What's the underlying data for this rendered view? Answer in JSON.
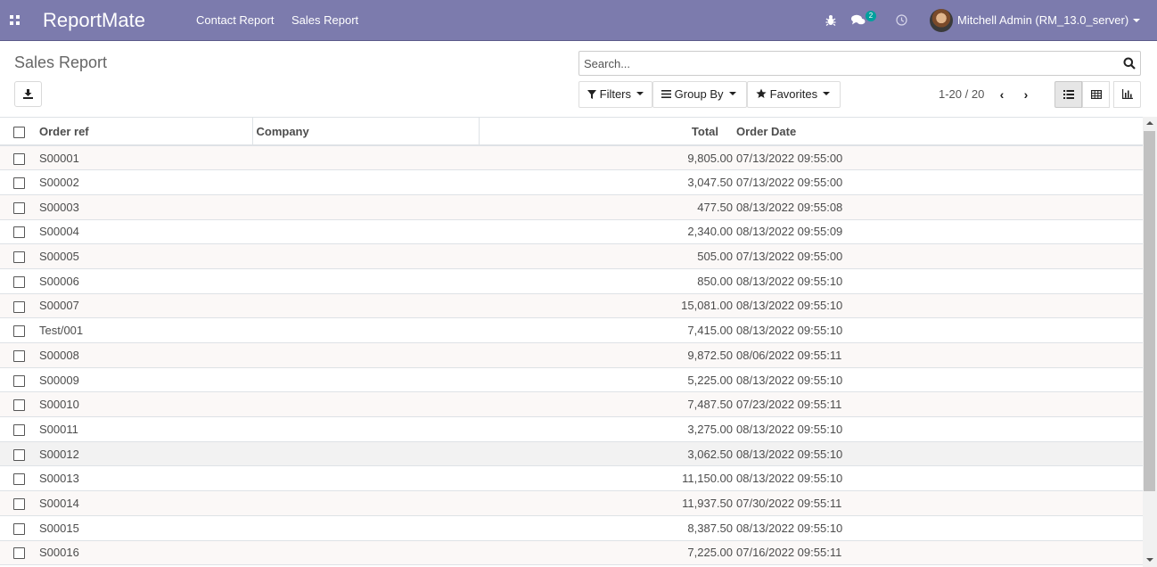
{
  "navbar": {
    "brand": "ReportMate",
    "menu": [
      "Contact Report",
      "Sales Report"
    ],
    "messages_badge": "2",
    "user_name": "Mitchell Admin (RM_13.0_server)",
    "icons": {
      "apps": "apps-grid-icon",
      "debug": "bug-icon",
      "messages": "chat-bubbles-icon",
      "activity": "clock-icon",
      "user_menu": "caret-down-icon"
    },
    "color": "#7c7bad"
  },
  "control_panel": {
    "breadcrumb": "Sales Report",
    "search_placeholder": "Search...",
    "filters_label": "Filters",
    "group_by_label": "Group By",
    "favorites_label": "Favorites",
    "pager": "1-20 / 20",
    "views": [
      "list",
      "pivot",
      "graph"
    ],
    "active_view": "list"
  },
  "list": {
    "columns": [
      "Order ref",
      "Company",
      "Total",
      "Order Date"
    ],
    "rows": [
      {
        "ref": "S00001",
        "company": "",
        "total": "9,805.00",
        "date": "07/13/2022 09:55:00"
      },
      {
        "ref": "S00002",
        "company": "",
        "total": "3,047.50",
        "date": "07/13/2022 09:55:00"
      },
      {
        "ref": "S00003",
        "company": "",
        "total": "477.50",
        "date": "08/13/2022 09:55:08"
      },
      {
        "ref": "S00004",
        "company": "",
        "total": "2,340.00",
        "date": "08/13/2022 09:55:09"
      },
      {
        "ref": "S00005",
        "company": "",
        "total": "505.00",
        "date": "07/13/2022 09:55:00"
      },
      {
        "ref": "S00006",
        "company": "",
        "total": "850.00",
        "date": "08/13/2022 09:55:10"
      },
      {
        "ref": "S00007",
        "company": "",
        "total": "15,081.00",
        "date": "08/13/2022 09:55:10"
      },
      {
        "ref": "Test/001",
        "company": "",
        "total": "7,415.00",
        "date": "08/13/2022 09:55:10"
      },
      {
        "ref": "S00008",
        "company": "",
        "total": "9,872.50",
        "date": "08/06/2022 09:55:11"
      },
      {
        "ref": "S00009",
        "company": "",
        "total": "5,225.00",
        "date": "08/13/2022 09:55:10"
      },
      {
        "ref": "S00010",
        "company": "",
        "total": "7,487.50",
        "date": "07/23/2022 09:55:11"
      },
      {
        "ref": "S00011",
        "company": "",
        "total": "3,275.00",
        "date": "08/13/2022 09:55:10"
      },
      {
        "ref": "S00012",
        "company": "",
        "total": "3,062.50",
        "date": "08/13/2022 09:55:10"
      },
      {
        "ref": "S00013",
        "company": "",
        "total": "11,150.00",
        "date": "08/13/2022 09:55:10"
      },
      {
        "ref": "S00014",
        "company": "",
        "total": "11,937.50",
        "date": "07/30/2022 09:55:11"
      },
      {
        "ref": "S00015",
        "company": "",
        "total": "8,387.50",
        "date": "08/13/2022 09:55:10"
      },
      {
        "ref": "S00016",
        "company": "",
        "total": "7,225.00",
        "date": "07/16/2022 09:55:11"
      }
    ],
    "hovered_row": 12
  }
}
